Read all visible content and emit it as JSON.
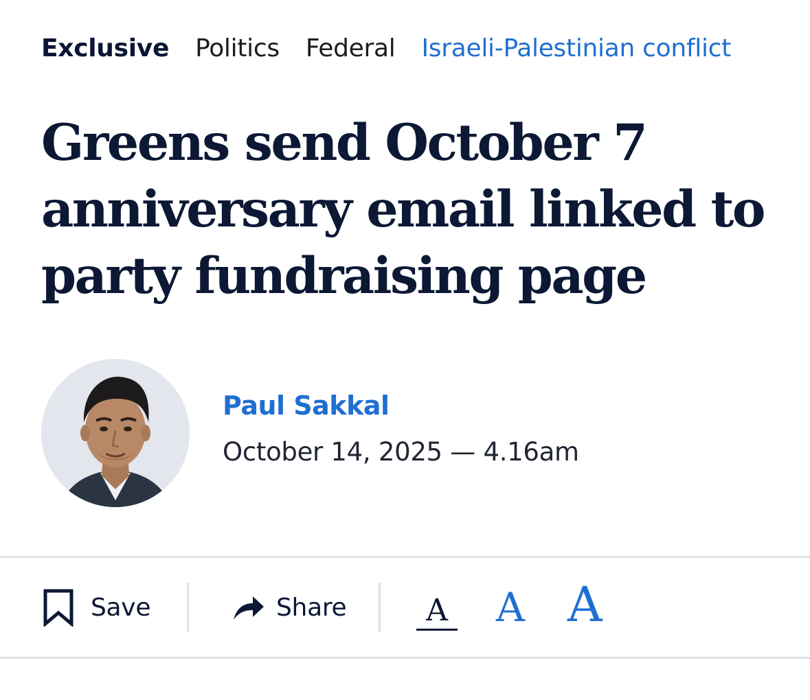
{
  "tags": [
    {
      "label": "Exclusive"
    },
    {
      "label": "Politics"
    },
    {
      "label": "Federal"
    },
    {
      "label": "Israeli-Palestinian conflict"
    }
  ],
  "headline": "Greens send October 7 anniversary email linked to party fundraising page",
  "byline": {
    "author": "Paul Sakkal",
    "date": "October 14, 2025",
    "separator": "—",
    "time": "4.16am"
  },
  "toolbar": {
    "save_label": "Save",
    "save_icon": "bookmark-icon",
    "share_label": "Share",
    "share_icon": "share-arrow-icon",
    "font_small": "A",
    "font_medium": "A",
    "font_large": "A",
    "selected_font_size": "small"
  },
  "colors": {
    "accent": "#1f6fd1",
    "headline": "#0c1834",
    "divider": "#dde0e6"
  }
}
